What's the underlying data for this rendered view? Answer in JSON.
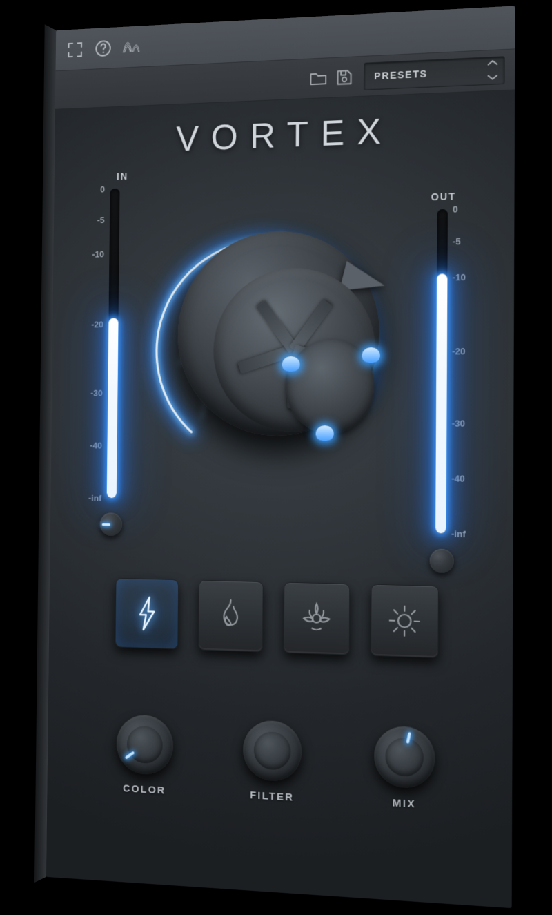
{
  "app": {
    "title": "VORTEX"
  },
  "toolbar": {
    "icons": [
      {
        "name": "fullscreen-icon",
        "label": "Resize"
      },
      {
        "name": "help-icon",
        "label": "Help"
      },
      {
        "name": "spectrum-icon",
        "label": "Analyzer"
      }
    ]
  },
  "presetbar": {
    "open_icon": "folder-open-icon",
    "save_icon": "save-disk-icon",
    "preset_name": "PRESETS",
    "prev_icon": "chevron-up-icon",
    "next_icon": "chevron-down-icon"
  },
  "meters": {
    "input": {
      "caption": "IN",
      "ticks": [
        "0",
        "-5",
        "-10",
        "-20",
        "-30",
        "-40",
        "-inf"
      ],
      "tick_positions": [
        0,
        10,
        21,
        44,
        66,
        83,
        100
      ],
      "level_percent": 58,
      "trim_value": 0
    },
    "output": {
      "caption": "OUT",
      "ticks": [
        "0",
        "-5",
        "-10",
        "-20",
        "-30",
        "-40",
        "-inf"
      ],
      "tick_positions": [
        0,
        10,
        21,
        44,
        66,
        83,
        100
      ],
      "level_percent": 80,
      "trim_value": 0
    }
  },
  "main_knob": {
    "name": "drive-knob",
    "arc_percent": 72,
    "accent_color": "#3aa0ff"
  },
  "modes": [
    {
      "name": "mode-lightning",
      "icon": "lightning-bolt-icon",
      "label": "Lightning",
      "active": true
    },
    {
      "name": "mode-flame",
      "icon": "flame-icon",
      "label": "Flame",
      "active": false
    },
    {
      "name": "mode-biohazard",
      "icon": "biohazard-icon",
      "label": "Biohazard",
      "active": false
    },
    {
      "name": "mode-sun",
      "icon": "sun-icon",
      "label": "Sun",
      "active": false
    }
  ],
  "knobs": [
    {
      "name": "color-knob",
      "label": "COLOR",
      "angle": -126,
      "has_indicator": true
    },
    {
      "name": "filter-knob",
      "label": "FILTER",
      "angle": 180,
      "has_indicator": false
    },
    {
      "name": "mix-knob",
      "label": "MIX",
      "angle": 12,
      "has_indicator": true
    }
  ],
  "colors": {
    "accent": "#3aa0ff",
    "glow": "#cfe9ff",
    "panel": "#2e3338",
    "toolbar": "#4a4f55",
    "text": "#c4cad0"
  }
}
